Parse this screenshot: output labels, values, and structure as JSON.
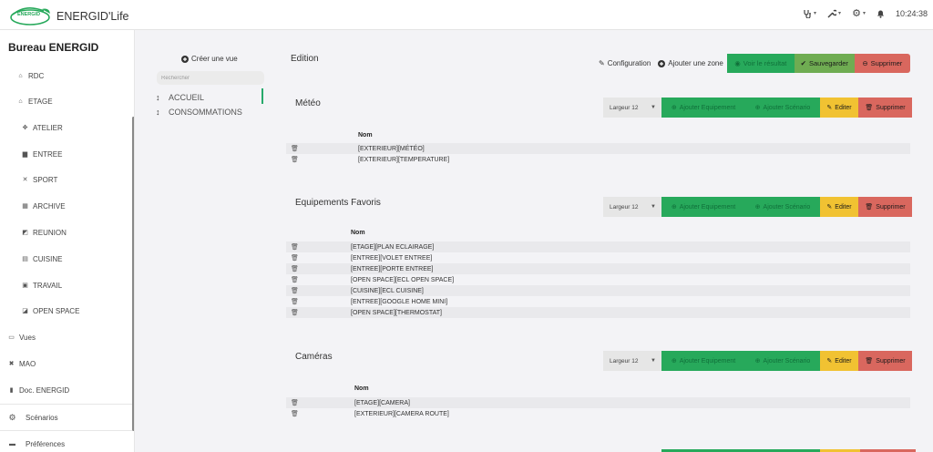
{
  "header": {
    "app_name": "ENERGID'Life",
    "logo_text": "ENERGID",
    "clock": "10:24:38",
    "icons": [
      "stethoscope-icon",
      "wrench-icon",
      "gear-icon",
      "bell-icon"
    ]
  },
  "sidebar": {
    "title": "Bureau ENERGID",
    "items": [
      {
        "label": "RDC",
        "icon": "home-icon"
      },
      {
        "label": "ETAGE",
        "icon": "home-icon"
      },
      {
        "label": "ATELIER",
        "icon": "tools-icon"
      },
      {
        "label": "ENTREE",
        "icon": "desk-icon"
      },
      {
        "label": "SPORT",
        "icon": "sport-icon"
      },
      {
        "label": "ARCHIVE",
        "icon": "archive-icon"
      },
      {
        "label": "REUNION",
        "icon": "meeting-icon"
      },
      {
        "label": "CUISINE",
        "icon": "kitchen-icon"
      },
      {
        "label": "TRAVAIL",
        "icon": "calendar-icon"
      },
      {
        "label": "OPEN SPACE",
        "icon": "openspace-icon"
      },
      {
        "label": "Vues",
        "icon": "image-icon"
      },
      {
        "label": "MAO",
        "icon": "tools-icon"
      },
      {
        "label": "Doc. ENERGID",
        "icon": "file-icon"
      }
    ],
    "footer_items": [
      {
        "label": "Scénarios",
        "icon": "gear-icon"
      },
      {
        "label": "Préférences",
        "icon": "briefcase-icon"
      }
    ]
  },
  "views": {
    "create_label": "Créer une vue",
    "search_placeholder": "Rechercher",
    "items": [
      "ACCUEIL",
      "CONSOMMATIONS"
    ]
  },
  "edition": {
    "title": "Edition",
    "configuration_label": "Configuration",
    "add_zone_label": "Ajouter une zone",
    "see_result_label": "Voir le résultat",
    "save_label": "Sauvegarder",
    "delete_label": "Supprimer"
  },
  "zone_toolbar": {
    "width_label": "Largeur 12",
    "add_equipment_label": "Ajouter Equipement",
    "add_scenario_label": "Ajouter Scénario",
    "edit_label": "Editer",
    "delete_label": "Supprimer"
  },
  "zones": [
    {
      "title": "Météo",
      "column_header": "Nom",
      "rows": [
        "[EXTERIEUR][MÉTÉO]",
        "[EXTERIEUR][TEMPERATURE]"
      ]
    },
    {
      "title": "Equipements Favoris",
      "column_header": "Nom",
      "rows": [
        "[ETAGE][PLAN ECLAIRAGE]",
        "[ENTREE][VOLET ENTREE]",
        "[ENTREE][PORTE ENTREE]",
        "[OPEN SPACE][ECL OPEN SPACE]",
        "[CUISINE][ECL CUISINE]",
        "[ENTREE][GOOGLE HOME MINI]",
        "[OPEN SPACE][THERMOSTAT]"
      ]
    },
    {
      "title": "Caméras",
      "column_header": "Nom",
      "rows": [
        "[ETAGE][CAMERA]",
        "[EXTERIEUR][CAMERA ROUTE]"
      ]
    }
  ],
  "colors": {
    "green": "#27a95b",
    "olive": "#6fac52",
    "yellow": "#f1c232",
    "red": "#d9675e",
    "active": "#27a96b"
  }
}
